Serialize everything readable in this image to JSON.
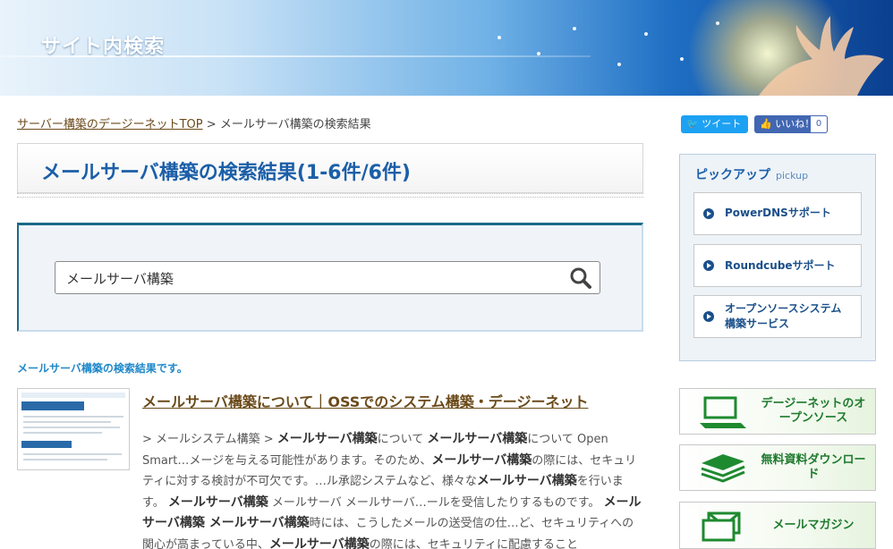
{
  "header": {
    "title": "サイト内検索"
  },
  "breadcrumb": {
    "home": "サーバー構築のデージーネットTOP",
    "separator": ">",
    "current": "メールサーバ構築の検索結果"
  },
  "main": {
    "heading": "メールサーバ構築の検索結果(1-6件/6件)",
    "search": {
      "value": "メールサーバ構築"
    },
    "result_note_term": "メールサーバ構築",
    "result_note_suffix": "の検索結果です。",
    "results": [
      {
        "title": "メールサーバ構築について｜OSSでのシステム構築・デージーネット",
        "snippet_parts": [
          {
            "t": "> メールシステム構築 > ",
            "b": false
          },
          {
            "t": "メールサーバ構築",
            "b": true
          },
          {
            "t": "について ",
            "b": false
          },
          {
            "t": "メールサーバ構築",
            "b": true
          },
          {
            "t": "について Open Smart…メージを与える可能性があります。そのため、",
            "b": false
          },
          {
            "t": "メールサーバ構築",
            "b": true
          },
          {
            "t": "の際には、セキュリティに対する検討が不可欠です。…ル承認システムなど、様々な",
            "b": false
          },
          {
            "t": "メールサーバ構築",
            "b": true
          },
          {
            "t": "を行います。 ",
            "b": false
          },
          {
            "t": "メールサーバ構築",
            "b": true
          },
          {
            "t": " メールサーバ メールサーバ…ールを受信したりするものです。 ",
            "b": false
          },
          {
            "t": "メールサーバ構築 メールサーバ構築",
            "b": true
          },
          {
            "t": "時には、こうしたメールの送受信の仕…ど、セキュリティへの関心が高まっている中、",
            "b": false
          },
          {
            "t": "メールサーバ構築",
            "b": true
          },
          {
            "t": "の際には、セキュリティに配慮すること",
            "b": false
          }
        ]
      }
    ]
  },
  "sidebar": {
    "tweet_label": "ツイート",
    "like_label": "いいね！",
    "like_count": "0",
    "pickup_title": "ピックアップ",
    "pickup_sub": "pickup",
    "pickup_items": [
      {
        "label": "PowerDNSサポート"
      },
      {
        "label": "Roundcubeサポート"
      },
      {
        "label": "オープンソースシステム構築サービス"
      }
    ],
    "banners": [
      {
        "label": "デージーネットのオープンソース",
        "icon": "laptop-icon"
      },
      {
        "label": "無料資料ダウンロード",
        "icon": "documents-icon"
      },
      {
        "label": "メールマガジン",
        "icon": "mail-icon"
      }
    ]
  },
  "colors": {
    "accent_blue": "#1b5fa8",
    "link_brown": "#6b4a1a",
    "note_blue": "#1f88c9",
    "banner_green": "#1e7a2e"
  }
}
